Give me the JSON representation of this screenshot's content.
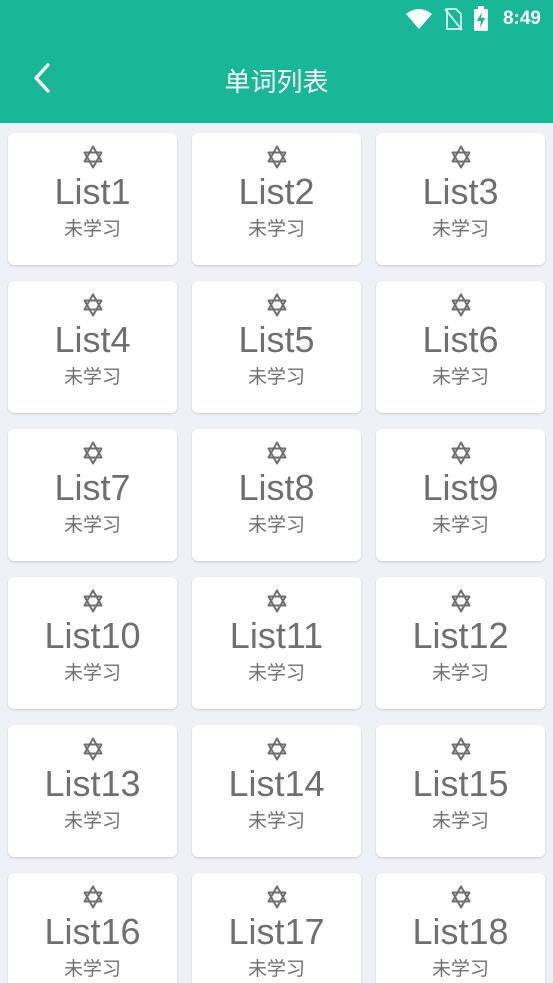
{
  "status_bar": {
    "time": "8:49",
    "icons": [
      "wifi-icon",
      "no-sim-icon",
      "battery-charging-icon"
    ]
  },
  "toolbar": {
    "title": "单词列表",
    "back_icon": "chevron-left-icon"
  },
  "colors": {
    "header": "#17b797",
    "background": "#eef1f5",
    "card": "#ffffff",
    "card_text": "#6f6f6f"
  },
  "lists": [
    {
      "title": "List1",
      "status": "未学习",
      "icon": "star-of-david-outline-icon"
    },
    {
      "title": "List2",
      "status": "未学习",
      "icon": "star-of-david-outline-icon"
    },
    {
      "title": "List3",
      "status": "未学习",
      "icon": "star-of-david-outline-icon"
    },
    {
      "title": "List4",
      "status": "未学习",
      "icon": "star-of-david-outline-icon"
    },
    {
      "title": "List5",
      "status": "未学习",
      "icon": "star-of-david-outline-icon"
    },
    {
      "title": "List6",
      "status": "未学习",
      "icon": "star-of-david-outline-icon"
    },
    {
      "title": "List7",
      "status": "未学习",
      "icon": "star-of-david-outline-icon"
    },
    {
      "title": "List8",
      "status": "未学习",
      "icon": "star-of-david-outline-icon"
    },
    {
      "title": "List9",
      "status": "未学习",
      "icon": "star-of-david-outline-icon"
    },
    {
      "title": "List10",
      "status": "未学习",
      "icon": "star-of-david-outline-icon"
    },
    {
      "title": "List11",
      "status": "未学习",
      "icon": "star-of-david-outline-icon"
    },
    {
      "title": "List12",
      "status": "未学习",
      "icon": "star-of-david-outline-icon"
    },
    {
      "title": "List13",
      "status": "未学习",
      "icon": "star-of-david-outline-icon"
    },
    {
      "title": "List14",
      "status": "未学习",
      "icon": "star-of-david-outline-icon"
    },
    {
      "title": "List15",
      "status": "未学习",
      "icon": "star-of-david-outline-icon"
    },
    {
      "title": "List16",
      "status": "未学习",
      "icon": "star-of-david-outline-icon"
    },
    {
      "title": "List17",
      "status": "未学习",
      "icon": "star-of-david-outline-icon"
    },
    {
      "title": "List18",
      "status": "未学习",
      "icon": "star-of-david-outline-icon"
    }
  ]
}
